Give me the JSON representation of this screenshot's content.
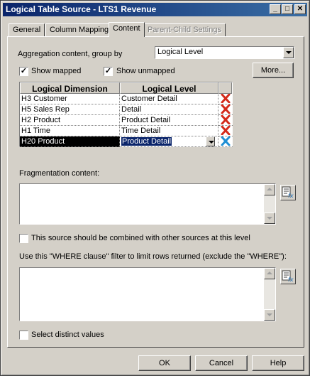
{
  "window": {
    "title": "Logical Table Source - LTS1 Revenue",
    "controls": {
      "minimize": "_",
      "maximize": "□",
      "close": "✕"
    }
  },
  "tabs": [
    {
      "label": "General",
      "state": "normal"
    },
    {
      "label": "Column Mapping",
      "state": "normal"
    },
    {
      "label": "Content",
      "state": "active"
    },
    {
      "label": "Parent-Child Settings",
      "state": "disabled"
    }
  ],
  "content": {
    "aggregation_label": "Aggregation content, group by",
    "aggregation_value": "Logical Level",
    "show_mapped": {
      "label": "Show mapped",
      "checked": true
    },
    "show_unmapped": {
      "label": "Show unmapped",
      "checked": true
    },
    "more_button": "More...",
    "grid": {
      "headers": [
        "Logical Dimension",
        "Logical Level"
      ],
      "rows": [
        {
          "dimension": "H3 Customer",
          "level": "Customer Detail",
          "action_icon": "delete-x-icon"
        },
        {
          "dimension": "H5 Sales Rep",
          "level": "Detail",
          "action_icon": "delete-x-icon"
        },
        {
          "dimension": "H2 Product",
          "level": "Product Detail",
          "action_icon": "delete-x-icon"
        },
        {
          "dimension": "H1 Time",
          "level": "Time Detail",
          "action_icon": "delete-x-icon"
        },
        {
          "dimension": "H20 Product",
          "level": "Product Detail",
          "action_icon": "delete-x-icon",
          "selected": true
        }
      ]
    },
    "fragmentation_label": "Fragmentation content:",
    "combine_checkbox": {
      "label": "This source should be combined with other sources at this level",
      "checked": false
    },
    "where_label": "Use this \"WHERE clause\" filter to limit rows returned (exclude the \"WHERE\"):",
    "distinct_checkbox": {
      "label": "Select distinct values",
      "checked": false
    }
  },
  "footer": {
    "ok": "OK",
    "cancel": "Cancel",
    "help": "Help"
  },
  "colors": {
    "title_start": "#0a246a",
    "title_end": "#3a6ea5",
    "selection": "#0a246a",
    "delete_red": "#d42a1a",
    "delete_blue": "#1f8fd4"
  }
}
